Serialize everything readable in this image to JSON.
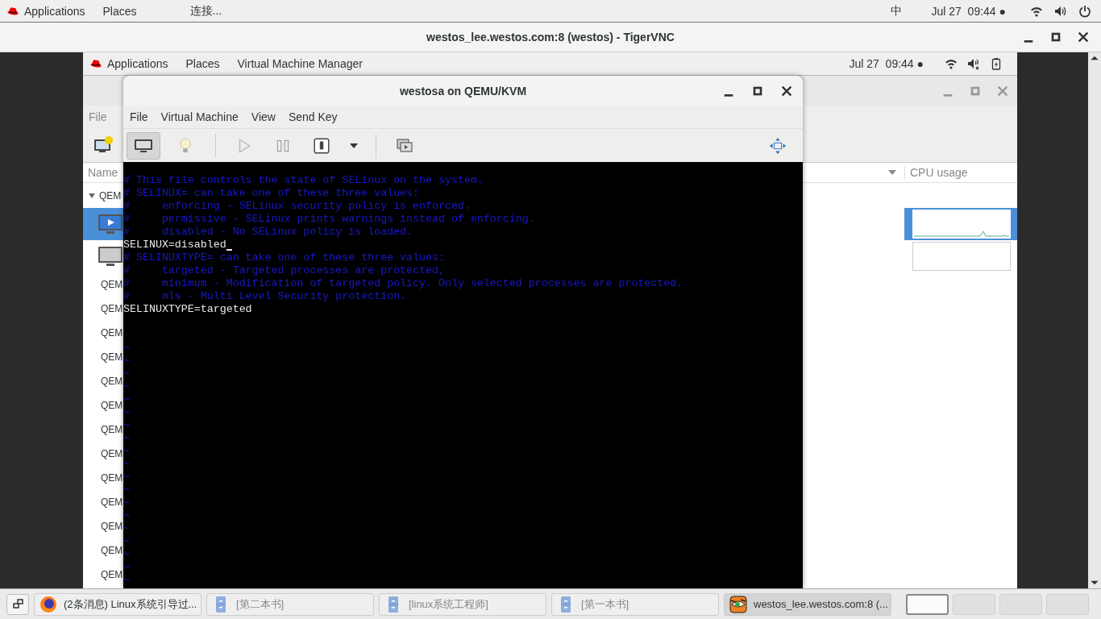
{
  "top_bar": {
    "menus": [
      "Applications",
      "Places"
    ],
    "app_label": "连接...",
    "input_method": "中",
    "clock": "Jul 27  09:44 ●"
  },
  "vnc_window": {
    "title": "westos_lee.westos.com:8 (westos) - TigerVNC"
  },
  "guest_top_bar": {
    "menus": [
      "Applications",
      "Places",
      "Virtual Machine Manager"
    ],
    "clock": "Jul 27  09:44 ●"
  },
  "manager_window": {
    "menus": [
      "File"
    ],
    "columns": [
      "Name",
      "CPU usage"
    ],
    "group": {
      "label": "QEM",
      "expanded": true
    },
    "vms": [
      {
        "selected": true
      },
      {
        "selected": false
      }
    ],
    "connections": [
      "QEM",
      "QEM",
      "QEM",
      "QEM",
      "QEM",
      "QEM",
      "QEM",
      "QEM",
      "QEM",
      "QEM",
      "QEM",
      "QEM",
      "QEM"
    ]
  },
  "console_window": {
    "title": "westosa on QEMU/KVM",
    "menus": [
      "File",
      "Virtual Machine",
      "View",
      "Send Key"
    ],
    "view_buttons": [
      {
        "kind": "console",
        "selected": true
      },
      {
        "kind": "details",
        "selected": false
      }
    ],
    "lines": [
      {
        "kind": "comment",
        "text": "# This file controls the state of SELinux on the system."
      },
      {
        "kind": "comment",
        "text": "# SELINUX= can take one of these three values:"
      },
      {
        "kind": "comment",
        "text": "#     enforcing - SELinux security policy is enforced."
      },
      {
        "kind": "comment",
        "text": "#     permissive - SELinux prints warnings instead of enforcing."
      },
      {
        "kind": "comment",
        "text": "#     disabled - No SELinux policy is loaded."
      },
      {
        "kind": "text",
        "text": "SELINUX=disabled",
        "cursor": true
      },
      {
        "kind": "comment",
        "text": "# SELINUXTYPE= can take one of these three values:"
      },
      {
        "kind": "comment",
        "text": "#     targeted - Targeted processes are protected,"
      },
      {
        "kind": "comment",
        "text": "#     minimum - Modification of targeted policy. Only selected processes are protected."
      },
      {
        "kind": "comment",
        "text": "#     mls - Multi Level Security protection."
      },
      {
        "kind": "text",
        "text": "SELINUXTYPE=targeted",
        "cursor": false
      },
      {
        "kind": "blank"
      },
      {
        "kind": "blank"
      },
      {
        "kind": "tilde",
        "text": "~"
      },
      {
        "kind": "tilde",
        "text": "~"
      },
      {
        "kind": "tilde",
        "text": "~"
      },
      {
        "kind": "tilde",
        "text": "~"
      },
      {
        "kind": "tilde",
        "text": "~"
      },
      {
        "kind": "tilde",
        "text": "~"
      },
      {
        "kind": "tilde",
        "text": "~"
      },
      {
        "kind": "tilde",
        "text": "~"
      },
      {
        "kind": "tilde",
        "text": "~"
      },
      {
        "kind": "tilde",
        "text": "~"
      },
      {
        "kind": "tilde",
        "text": "~"
      },
      {
        "kind": "tilde",
        "text": "~"
      },
      {
        "kind": "tilde",
        "text": "~"
      },
      {
        "kind": "tilde",
        "text": "~"
      },
      {
        "kind": "tilde",
        "text": "~"
      },
      {
        "kind": "tilde",
        "text": "~"
      },
      {
        "kind": "tilde",
        "text": "~"
      },
      {
        "kind": "tilde",
        "text": "~"
      },
      {
        "kind": "tilde",
        "text": "~"
      }
    ]
  },
  "taskbar": {
    "tasks": [
      {
        "kind": "firefox",
        "label": "(2条消息) Linux系统引导过...",
        "selected": false
      },
      {
        "kind": "file",
        "label": "[第二本书]",
        "selected": false
      },
      {
        "kind": "file",
        "label": "[linux系统工程师]",
        "selected": false
      },
      {
        "kind": "file",
        "label": "[第一本书]",
        "selected": false
      },
      {
        "kind": "vnc",
        "label": "westos_lee.westos.com:8 (...",
        "selected": true
      }
    ],
    "workspaces": [
      {
        "selected": true
      },
      {
        "selected": false
      },
      {
        "selected": false
      },
      {
        "selected": false
      }
    ]
  }
}
